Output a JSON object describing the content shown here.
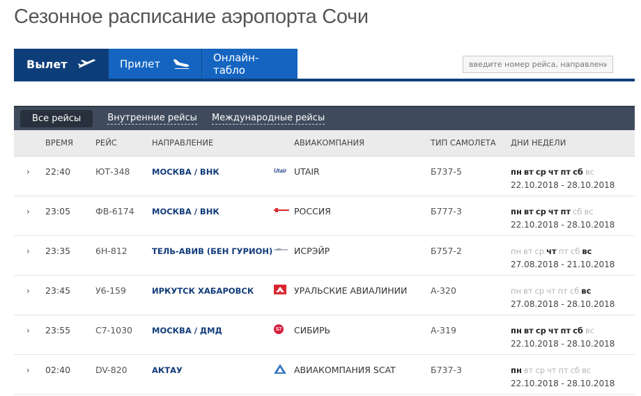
{
  "page": {
    "title": "Сезонное расписание аэропорта Сочи"
  },
  "tabs": [
    {
      "label": "Вылет",
      "icon": "plane-takeoff-icon"
    },
    {
      "label": "Прилет",
      "icon": "plane-landing-icon"
    },
    {
      "label": "Онлайн-табло"
    }
  ],
  "search": {
    "placeholder": "введите номер рейса, направление"
  },
  "filters": {
    "all": "Все рейсы",
    "domestic": "Внутренние рейсы",
    "international": "Международные рейсы"
  },
  "columns": {
    "time": "Время",
    "flight": "Рейс",
    "destination": "Направление",
    "airline": "Авиакомпания",
    "aircraft": "Тип самолета",
    "days": "Дни недели"
  },
  "day_names": [
    "пн",
    "вт",
    "ср",
    "чт",
    "пт",
    "сб",
    "вс"
  ],
  "colors": {
    "departures_tab": "#0d3e7a",
    "tab": "#1565c0",
    "filter_bar": "#3f4b5c",
    "destination_text": "#123c7a"
  },
  "flights": [
    {
      "time": "22:40",
      "flight": "ЮТ-348",
      "destination": "МОСКВА / ВНК",
      "airline": "UTAIR",
      "logo_text": "Utair",
      "aircraft": "Б737-5",
      "days_active": [
        true,
        true,
        true,
        true,
        true,
        true,
        false
      ],
      "period": "22.10.2018 - 28.10.2018"
    },
    {
      "time": "23:05",
      "flight": "ФВ-6174",
      "destination": "МОСКВА / ВНК",
      "airline": "РОССИЯ",
      "aircraft": "Б777-3",
      "days_active": [
        true,
        true,
        true,
        true,
        true,
        false,
        false
      ],
      "period": "22.10.2018 - 28.10.2018"
    },
    {
      "time": "23:35",
      "flight": "6Н-812",
      "destination": "ТЕЛЬ-АВИВ (БЕН ГУРИОН)",
      "airline": "ИСРЭЙР",
      "aircraft": "Б757-2",
      "days_active": [
        false,
        false,
        false,
        true,
        false,
        false,
        true
      ],
      "period": "27.08.2018 - 21.10.2018"
    },
    {
      "time": "23:45",
      "flight": "У6-159",
      "destination": "ИРКУТСК ХАБАРОВСК",
      "airline": "УРАЛЬСКИЕ АВИАЛИНИИ",
      "aircraft": "А-320",
      "days_active": [
        false,
        false,
        false,
        false,
        false,
        false,
        true
      ],
      "period": "27.08.2018 - 28.10.2018"
    },
    {
      "time": "23:55",
      "flight": "С7-1030",
      "destination": "МОСКВА / ДМД",
      "airline": "СИБИРЬ",
      "logo_text": "S7",
      "aircraft": "А-319",
      "days_active": [
        true,
        true,
        true,
        true,
        true,
        true,
        false
      ],
      "period": "22.10.2018 - 28.10.2018"
    },
    {
      "time": "02:40",
      "flight": "DV-820",
      "destination": "АКТАУ",
      "airline": "АВИАКОМПАНИЯ SCAT",
      "aircraft": "Б737-3",
      "days_active": [
        true,
        false,
        false,
        false,
        false,
        false,
        false
      ],
      "period": "22.10.2018 - 28.10.2018"
    }
  ]
}
